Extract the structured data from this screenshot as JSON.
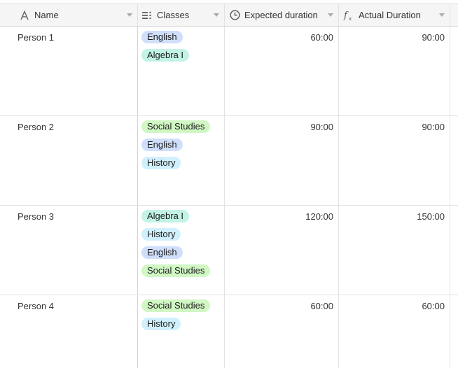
{
  "columns": [
    {
      "label": "Name",
      "icon": "text-field-icon"
    },
    {
      "label": "Classes",
      "icon": "multi-select-icon"
    },
    {
      "label": "Expected duration",
      "icon": "clock-icon"
    },
    {
      "label": "Actual Duration",
      "icon": "formula-icon"
    }
  ],
  "tag_colors": {
    "English": "#cfdffb",
    "Algebra I": "#c2f3e6",
    "Social Studies": "#d1f7c4",
    "History": "#d0f0fd"
  },
  "rows": [
    {
      "name": "Person 1",
      "classes": [
        "English",
        "Algebra I"
      ],
      "expected": "60:00",
      "actual": "90:00"
    },
    {
      "name": "Person 2",
      "classes": [
        "Social Studies",
        "English",
        "History"
      ],
      "expected": "90:00",
      "actual": "90:00"
    },
    {
      "name": "Person 3",
      "classes": [
        "Algebra I",
        "History",
        "English",
        "Social Studies"
      ],
      "expected": "120:00",
      "actual": "150:00"
    },
    {
      "name": "Person 4",
      "classes": [
        "Social Studies",
        "History"
      ],
      "expected": "60:00",
      "actual": "60:00"
    }
  ]
}
